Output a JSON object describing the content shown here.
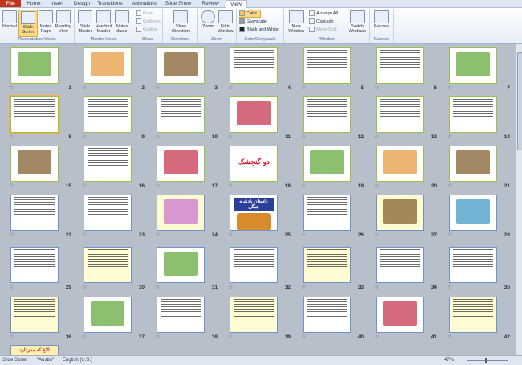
{
  "ribbon_tabs": [
    "File",
    "Home",
    "Insert",
    "Design",
    "Transitions",
    "Animations",
    "Slide Show",
    "Review",
    "View"
  ],
  "active_tab": "View",
  "groups": {
    "presentation_views": {
      "label": "Presentation Views",
      "buttons": [
        "Normal",
        "Slide Sorter",
        "Notes Page",
        "Reading View"
      ]
    },
    "master_views": {
      "label": "Master Views",
      "buttons": [
        "Slide Master",
        "Handout Master",
        "Notes Master"
      ]
    },
    "show": {
      "label": "Show",
      "items": [
        "Ruler",
        "Gridlines",
        "Guides"
      ]
    },
    "direction": {
      "label": "Direction",
      "button": "View Direction"
    },
    "zoom": {
      "label": "Zoom",
      "buttons": [
        "Zoom",
        "Fit to Window"
      ]
    },
    "color": {
      "label": "Color/Grayscale",
      "items": [
        "Color",
        "Grayscale",
        "Black and White"
      ]
    },
    "window": {
      "label": "Window",
      "new_window": "New Window",
      "items": [
        "Arrange All",
        "Cascade",
        "Move Split"
      ],
      "switch": "Switch Windows"
    },
    "macros": {
      "label": "Macros",
      "button": "Macros"
    }
  },
  "slides": {
    "row_numbers": [
      [
        1,
        2,
        3,
        4,
        5,
        6,
        7
      ],
      [
        8,
        9,
        10,
        11,
        12,
        13,
        14
      ],
      [
        15,
        16,
        17,
        18,
        19,
        20,
        21
      ],
      [
        22,
        23,
        24,
        25,
        26,
        27,
        28
      ],
      [
        29,
        30,
        31,
        32,
        33,
        34,
        35
      ],
      [
        36,
        37,
        38,
        39,
        40,
        41,
        42
      ]
    ],
    "selected_slide": 8,
    "slide18_title": "دو گنجشک",
    "slide25_title": "داستان پادشاه جنگل",
    "partial_slide_title": "الاغ که معزدارد"
  },
  "status_bar": {
    "view": "Slide Sorter",
    "theme": "\"Austin\"",
    "language": "English (U.S.)",
    "zoom": "47%"
  },
  "colors": {
    "ribbon_bg": "#e6edf7",
    "file_tab": "#c0341d",
    "sorter_bg": "#b6bfca",
    "selected": "#f0b43c"
  }
}
